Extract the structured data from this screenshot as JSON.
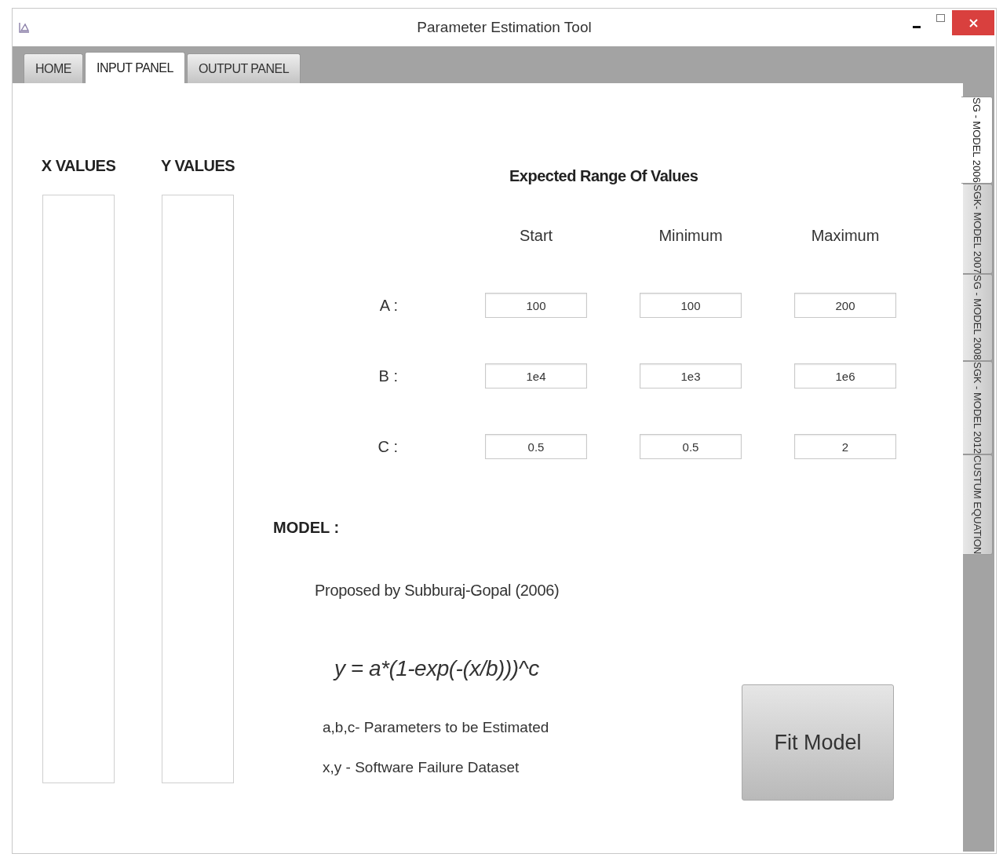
{
  "window": {
    "title": "Parameter Estimation Tool"
  },
  "tabs": [
    {
      "label": "HOME",
      "selected": false
    },
    {
      "label": "INPUT PANEL",
      "selected": true
    },
    {
      "label": "OUTPUT PANEL",
      "selected": false
    }
  ],
  "side_tabs": [
    {
      "label": "SG - MODEL 2006",
      "selected": true
    },
    {
      "label": "SGK- MODEL 2007",
      "selected": false
    },
    {
      "label": "SG - MODEL 2008",
      "selected": false
    },
    {
      "label": "SGK - MODEL 2012",
      "selected": false
    },
    {
      "label": "CUSTUM EQUATION",
      "selected": false
    }
  ],
  "data_columns": [
    {
      "label": "X VALUES"
    },
    {
      "label": "Y VALUES"
    }
  ],
  "range": {
    "title": "Expected Range Of Values",
    "columns": [
      "Start",
      "Minimum",
      "Maximum"
    ],
    "rows": [
      {
        "label": "A :",
        "values": [
          "100",
          "100",
          "200"
        ]
      },
      {
        "label": "B :",
        "values": [
          "1e4",
          "1e3",
          "1e6"
        ]
      },
      {
        "label": "C :",
        "values": [
          "0.5",
          "0.5",
          "2"
        ]
      }
    ]
  },
  "model": {
    "heading": "MODEL :",
    "description": "Proposed by Subburaj-Gopal (2006)",
    "equation": "y = a*(1-exp(-(x/b)))^c",
    "notes": [
      "a,b,c- Parameters to be Estimated",
      "x,y - Software Failure Dataset"
    ]
  },
  "fit_button": "Fit Model"
}
